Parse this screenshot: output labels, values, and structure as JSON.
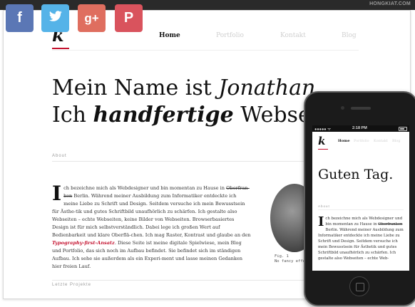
{
  "brand": "HONGKIAT.COM",
  "social": [
    {
      "name": "facebook",
      "glyph": "f",
      "color": "#5b77b5"
    },
    {
      "name": "twitter",
      "glyph": "🐦",
      "color": "#55b3e8"
    },
    {
      "name": "google-plus",
      "glyph": "g+",
      "color": "#df6e5f"
    },
    {
      "name": "pinterest",
      "glyph": "P",
      "color": "#d9535d"
    }
  ],
  "site": {
    "logo": "k",
    "nav": [
      "Home",
      "Portfolio",
      "Kontakt",
      "Blog"
    ],
    "hero_line1_a": "Mein Name ist ",
    "hero_line1_b": "Jonathan.",
    "hero_line2_a": "Ich ",
    "hero_line2_b": "handfertige",
    "hero_line2_c": " Webseit",
    "about_label": "About",
    "about": {
      "dropcap": "I",
      "p1": "ch bezeichne mich als Webdesigner und bin momentan zu Hause in ",
      "strike": "Oberfran-ken",
      "p2": " Berlin. Während meiner Ausbildung zum Informatiker entdeckte ich meine Liebe zu Schrift und Design. Seitdem versuche ich mein Bewusstsein für Ästhe-tik und gutes Schriftbild unaufhörlich zu schärfen. Ich gestalte also Webseiten – echte Webseiten, keine Bilder von Webseiten. Browserbasiertes Design ist für mich selbstverständlich. Dabei lege ich großen Wert auf Bedienbarkeit und klare Oberflä-chen. Ich mag Raster, Kontrast und glaube an den ",
      "link": "Typography-first-Ansatz",
      "p3": ". Diese Seite ist meine digitale Spielwiese, mein Blog und Portfolio, das sich noch im Aufbau befindet. Sie befindet sich im ständigen Aufbau. Ich sehe sie außerdem als ein Experi-ment und lasse meinen Gedanken hier freien Lauf."
    },
    "caption_1": "Fig. 1",
    "caption_2": "No fancy effe",
    "projects_label": "Letzte Projekte"
  },
  "mobile": {
    "status_carrier": "●●●●● ᯤ",
    "status_time": "2:18 PM",
    "logo": "k",
    "nav": [
      "Home",
      "Portfolio",
      "Kontakt",
      "Blog"
    ],
    "hero": "Guten Tag.",
    "about_label": "About",
    "dropcap": "I",
    "p1": "ch bezeichne mich als Webdesigner und bin momentan zu Hause in ",
    "strike": "Oberfranken",
    "p2": " Berlin. Während meiner Ausbildung zum Informatiker entdeckte ich meine Liebe zu Schrift und Design. Seitdem versuche ich mein Bewusstsein für Ästhetik und gutes Schriftbild unaufhörlich zu schärfen. Ich gestalte also Webseiten – echte Web-"
  }
}
